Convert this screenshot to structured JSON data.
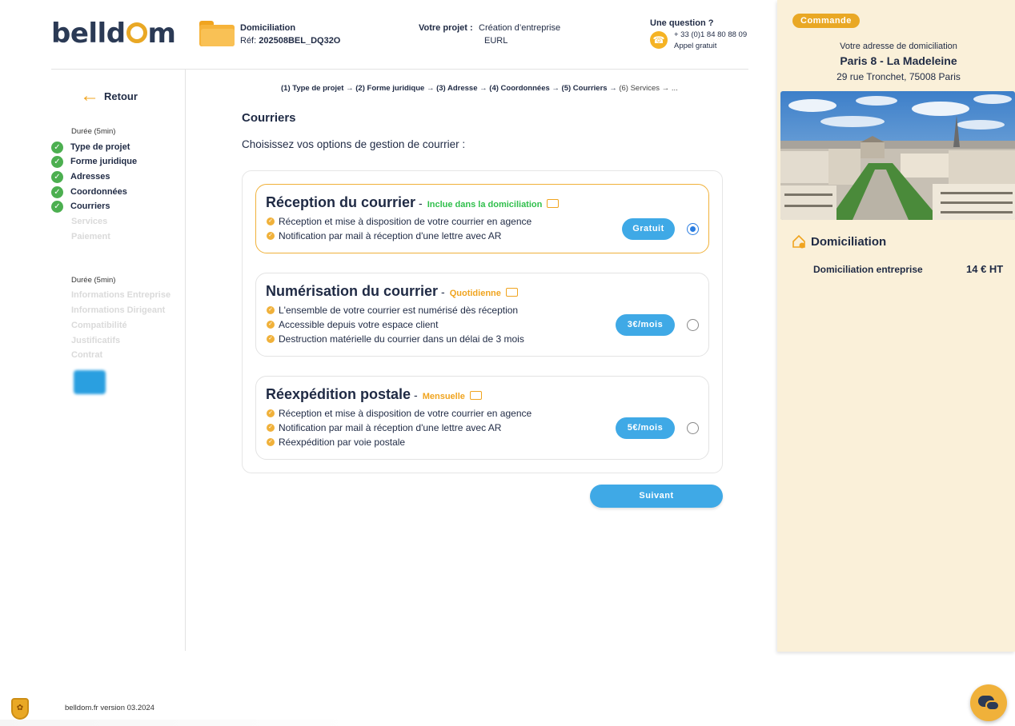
{
  "header": {
    "logo": "belldom",
    "title": "Domiciliation",
    "ref_label": "Réf:",
    "ref_value": "202508BEL_DQ32O",
    "project_label": "Votre projet :",
    "project_value1": "Création d’entreprise",
    "project_value2": "EURL",
    "question_label": "Une question ?",
    "phone": "+ 33 (0)1 84 80 88 09",
    "phone_note": "Appel gratuit"
  },
  "sidebar": {
    "back_label": "Retour",
    "duration1": "Durée (5min)",
    "steps_done": [
      "Type de projet",
      "Forme juridique",
      "Adresses",
      "Coordonnées",
      "Courriers"
    ],
    "steps_todo": [
      "Services",
      "Paiement"
    ],
    "duration2": "Durée (5min)",
    "steps_later": [
      "Informations Entreprise",
      "Informations Dirigeant",
      "Compatibilité",
      "Justificatifs",
      "Contrat"
    ]
  },
  "breadcrumb": {
    "s1": "(1) Type de projet",
    "s2": "(2) Forme juridique",
    "s3": "(3) Adresse",
    "s4": "(4) Coordonnées",
    "s5": "(5) Courriers",
    "s6": "(6) Services",
    "more": "..."
  },
  "main": {
    "title": "Courriers",
    "subtitle": "Choisissez vos options de gestion de courrier :",
    "options": [
      {
        "title": "Réception du courrier",
        "tag": "Inclue dans la domiciliation",
        "features": [
          "Réception et mise à disposition de votre courrier en agence",
          "Notification par mail à réception d'une lettre avec AR"
        ],
        "price": "Gratuit",
        "selected": true
      },
      {
        "title": "Numérisation du courrier",
        "tag": "Quotidienne",
        "features": [
          "L'ensemble de votre courrier est numérisé dès réception",
          "Accessible depuis votre espace client",
          "Destruction matérielle du courrier dans un délai de 3 mois"
        ],
        "price": "3€/mois",
        "selected": false
      },
      {
        "title": "Réexpédition postale",
        "tag": "Mensuelle",
        "features": [
          "Réception et mise à disposition de votre courrier en agence",
          "Notification par mail à réception d'une lettre avec AR",
          "Réexpédition par voie postale"
        ],
        "price": "5€/mois",
        "selected": false
      }
    ],
    "next_label": "Suivant"
  },
  "order": {
    "badge": "Commande",
    "address_label": "Votre adresse de domiciliation",
    "city": "Paris 8 - La Madeleine",
    "street": "29 rue Tronchet, 75008 Paris",
    "section_title": "Domiciliation",
    "line_label": "Domiciliation entreprise",
    "line_value": "14 € HT"
  },
  "footer": {
    "version": "belldom.fr version 03.2024"
  },
  "colors": {
    "accent": "#f0a41f",
    "button_blue": "#3fa9e6",
    "panel_bg": "#faf0d9",
    "check_green": "#4caf50",
    "text_dark": "#1f2a44"
  }
}
